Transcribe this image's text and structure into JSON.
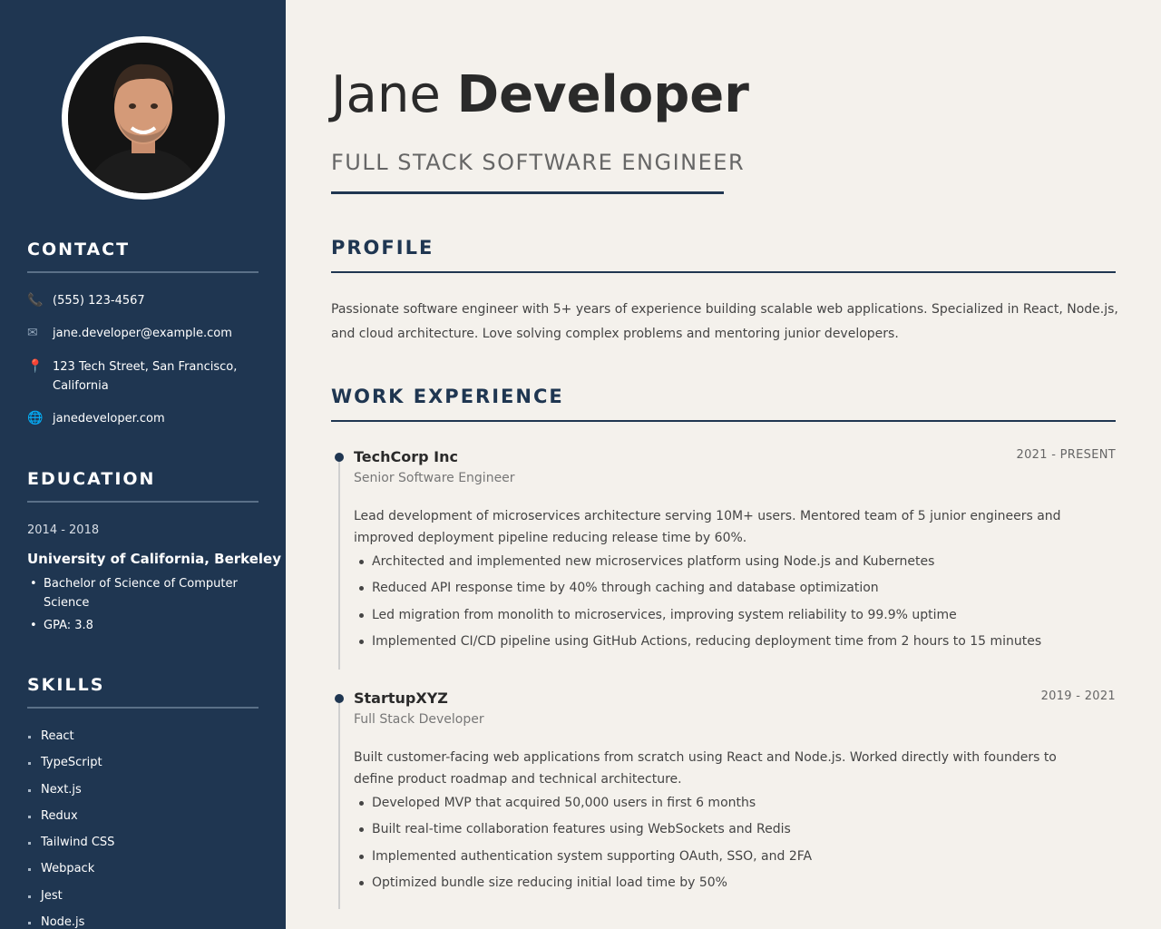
{
  "person": {
    "first_name": "Jane",
    "last_name": "Developer",
    "title": "FULL STACK SOFTWARE ENGINEER"
  },
  "sidebar": {
    "contact": {
      "heading": "CONTACT",
      "phone": {
        "icon": "phone-icon",
        "text": "(555) 123-4567"
      },
      "email": {
        "icon": "envelope-icon",
        "text": "jane.developer@example.com"
      },
      "address": {
        "icon": "map-pin-icon",
        "line1": "123 Tech Street, San Francisco,",
        "line2": "California"
      },
      "website": {
        "icon": "globe-icon",
        "text": "janedeveloper.com"
      }
    },
    "education": {
      "heading": "EDUCATION",
      "years": "2014 - 2018",
      "school": "University of California, Berkeley",
      "items": [
        "Bachelor of Science of Computer Science",
        "GPA: 3.8"
      ]
    },
    "skills": {
      "heading": "SKILLS",
      "items": [
        "React",
        "TypeScript",
        "Next.js",
        "Redux",
        "Tailwind CSS",
        "Webpack",
        "Jest",
        "Node.js"
      ]
    }
  },
  "main": {
    "profile": {
      "heading": "PROFILE",
      "text": "Passionate software engineer with 5+ years of experience building scalable web applications. Specialized in React, Node.js, and cloud architecture. Love solving complex problems and mentoring junior developers."
    },
    "experience": {
      "heading": "WORK EXPERIENCE",
      "jobs": [
        {
          "company": "TechCorp Inc",
          "dates": "2021 - PRESENT",
          "role": "Senior Software Engineer",
          "description": "Lead development of microservices architecture serving 10M+ users. Mentored team of 5 junior engineers and improved deployment pipeline reducing release time by 60%.",
          "bullets": [
            "Architected and implemented new microservices platform using Node.js and Kubernetes",
            "Reduced API response time by 40% through caching and database optimization",
            "Led migration from monolith to microservices, improving system reliability to 99.9% uptime",
            "Implemented CI/CD pipeline using GitHub Actions, reducing deployment time from 2 hours to 15 minutes"
          ]
        },
        {
          "company": "StartupXYZ",
          "dates": "2019 - 2021",
          "role": "Full Stack Developer",
          "description": "Built customer-facing web applications from scratch using React and Node.js. Worked directly with founders to define product roadmap and technical architecture.",
          "bullets": [
            "Developed MVP that acquired 50,000 users in first 6 months",
            "Built real-time collaboration features using WebSockets and Redis",
            "Implemented authentication system supporting OAuth, SSO, and 2FA",
            "Optimized bundle size reducing initial load time by 50%"
          ]
        }
      ]
    }
  },
  "colors": {
    "sidebar_bg": "#1f3651",
    "accent": "#1f3651",
    "page_bg": "#f4f1ec"
  }
}
